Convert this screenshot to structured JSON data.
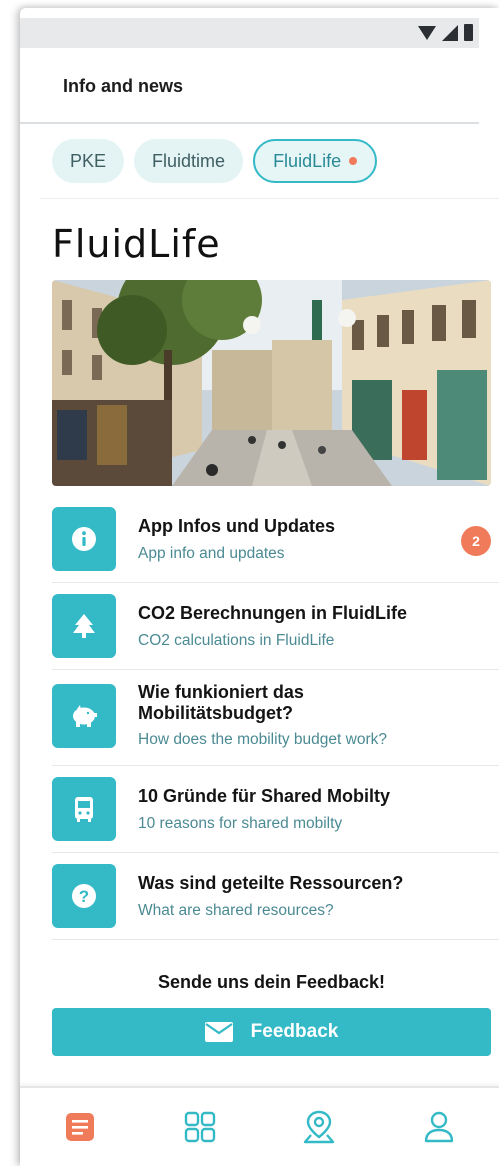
{
  "header": {
    "title": "Info and news"
  },
  "tabs": [
    {
      "label": "PKE",
      "active": false
    },
    {
      "label": "Fluidtime",
      "active": false
    },
    {
      "label": "FluidLife",
      "active": true,
      "dot": true
    }
  ],
  "page_title": "FluidLife",
  "hero": {
    "description": "Street scene photo"
  },
  "items": [
    {
      "icon": "info-icon",
      "title": "App Infos und Updates",
      "subtitle": "App info and updates",
      "badge": "2"
    },
    {
      "icon": "tree-icon",
      "title": "CO2 Berechnungen in FluidLife",
      "subtitle": "CO2 calculations in FluidLife"
    },
    {
      "icon": "piggy-bank-icon",
      "title_line1": "Wie funkioniert das",
      "title_line2": "Mobilitätsbudget?",
      "subtitle": "How does the mobility budget work?"
    },
    {
      "icon": "bus-icon",
      "title": "10 Gründe für Shared Mobilty",
      "subtitle": "10 reasons for shared mobilty"
    },
    {
      "icon": "question-icon",
      "title": "Was sind geteilte Ressourcen?",
      "subtitle": "What are shared resources?"
    }
  ],
  "feedback": {
    "prompt": "Sende uns dein Feedback!",
    "button_label": "Feedback"
  },
  "bottom_nav": [
    {
      "icon": "news-icon",
      "active": true
    },
    {
      "icon": "grid-icon",
      "active": false
    },
    {
      "icon": "map-pin-icon",
      "active": false
    },
    {
      "icon": "user-icon",
      "active": false
    }
  ],
  "colors": {
    "accent": "#34b9c7",
    "badge": "#f07b5a",
    "active_nav": "#f07b5a",
    "subtitle": "#4b8a93"
  }
}
